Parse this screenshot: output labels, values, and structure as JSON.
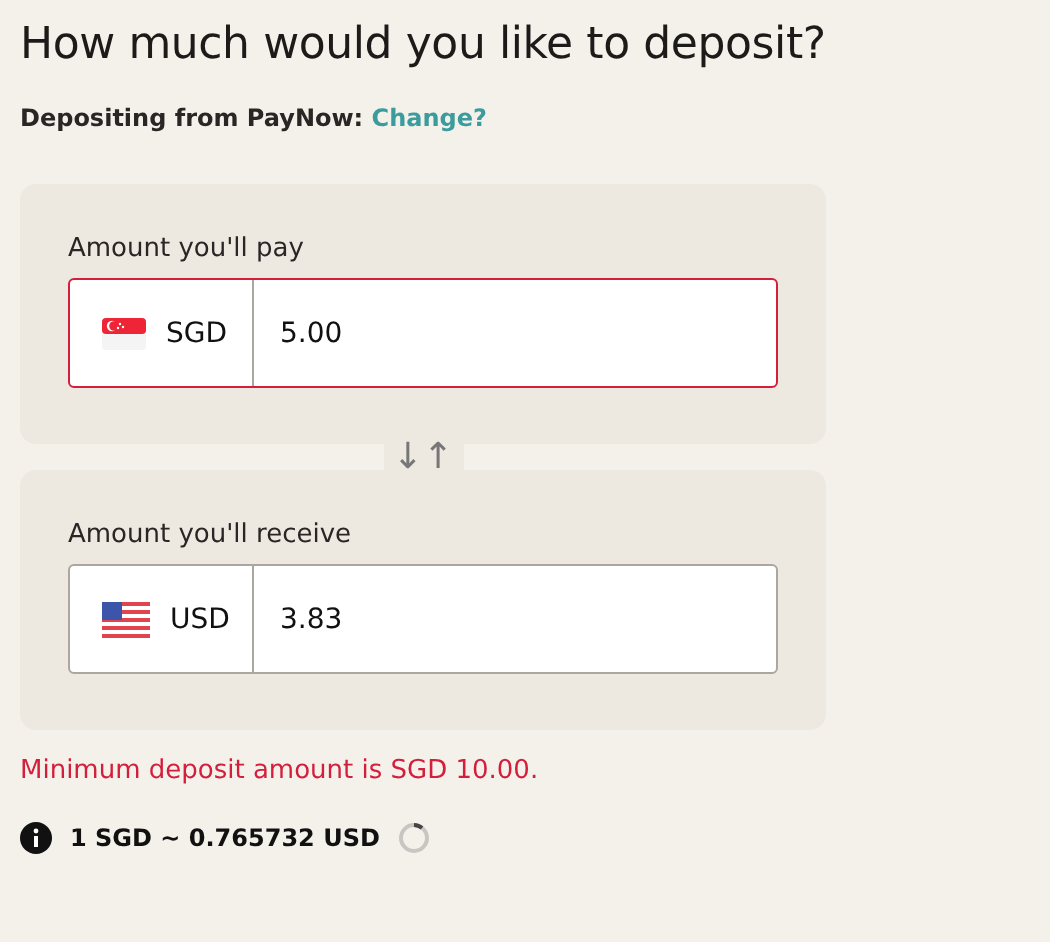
{
  "heading": "How much would you like to deposit?",
  "source": {
    "label": "Depositing from PayNow:",
    "link": "Change?"
  },
  "amounts": [
    {
      "label": "Amount you'll pay",
      "kind": "sg",
      "currency": "SGD",
      "value": "5.00",
      "invalid": true
    },
    {
      "label": "Amount you'll receive",
      "kind": "us",
      "currency": "USD",
      "value": "3.83",
      "invalid": false
    }
  ],
  "swap": {
    "symbol": "↓↑"
  },
  "error": "Minimum deposit amount is SGD 10.00.",
  "rate": {
    "text": "1 SGD ~ 0.765732 USD",
    "loading": true
  }
}
